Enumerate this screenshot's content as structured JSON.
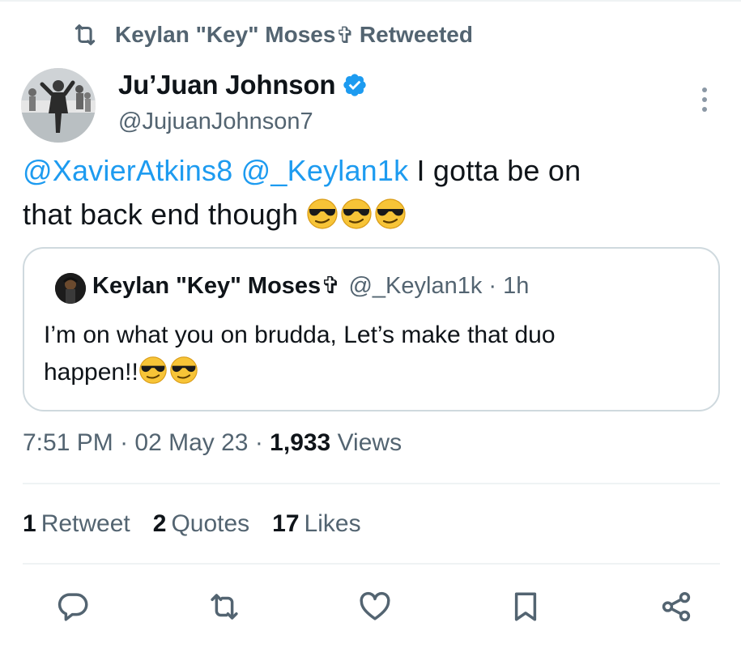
{
  "colors": {
    "accent": "#1d9bf0",
    "text_primary": "#0f1419",
    "text_secondary": "#536471",
    "border": "#cfd9de",
    "divider": "#eff3f4"
  },
  "retweet_banner": {
    "icon": "retweet-icon",
    "retweeter_name": "Keylan \"Key\" Moses",
    "cross_glyph": "✞",
    "label": "Retweeted"
  },
  "author": {
    "display_name": "Ju’Juan Johnson",
    "handle": "@JujuanJohnson7",
    "verified_icon": "verified-badge-icon"
  },
  "tweet": {
    "mention_1": "@XavierAtkins8",
    "mention_2": "@_Keylan1k",
    "text_line_1": " I gotta be on",
    "text_line_2": "that back end though ",
    "emoji_icon": "sunglasses-emoji-icon"
  },
  "quoted_tweet": {
    "display_name": "Keylan \"Key\" Moses",
    "cross_glyph": "✞",
    "handle": "@_Keylan1k",
    "time": "· 1h",
    "text_line_1": "I’m on what you on brudda, Let’s make that duo",
    "text_line_2": "happen!!"
  },
  "meta": {
    "time": "7:51 PM",
    "sep1": " · ",
    "date": "02 May 23",
    "sep2": " · ",
    "views_count": "1,933",
    "views_label": " Views"
  },
  "stats": {
    "retweets_count": "1",
    "retweets_label": "Retweet",
    "quotes_count": "2",
    "quotes_label": "Quotes",
    "likes_count": "17",
    "likes_label": "Likes"
  },
  "actions": [
    "reply-icon",
    "retweet-icon",
    "like-icon",
    "bookmark-icon",
    "share-icon"
  ]
}
